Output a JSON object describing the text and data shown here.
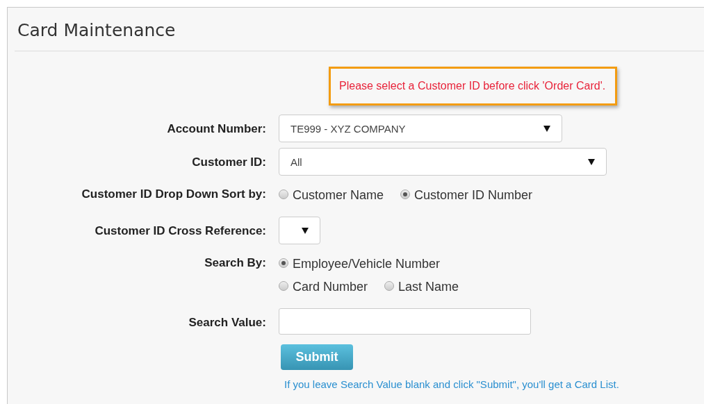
{
  "title": "Card Maintenance",
  "alert": "Please select a Customer ID before click 'Order Card'.",
  "fields": [
    {
      "kind": "select",
      "label": "Account Number:",
      "value": "TE999 - XYZ COMPANY"
    },
    {
      "kind": "select",
      "label": "Customer ID:",
      "value": "All"
    },
    {
      "kind": "radios",
      "label": "Customer ID Drop Down Sort by:",
      "lines": [
        [
          {
            "label": "Customer Name",
            "selected": false
          },
          {
            "label": "Customer ID Number",
            "selected": true
          }
        ]
      ]
    },
    {
      "kind": "select",
      "label": "Customer ID Cross Reference:"
    },
    {
      "kind": "radios",
      "label": "Search By:",
      "lines": [
        [
          {
            "label": "Employee/Vehicle Number",
            "selected": true
          }
        ],
        [
          {
            "label": "Card Number",
            "selected": false
          },
          {
            "label": "Last Name",
            "selected": false
          }
        ]
      ]
    },
    {
      "kind": "input",
      "label": "Search Value:"
    }
  ],
  "submit": "Submit",
  "note": "If you leave Search Value blank and click \"Submit\", you'll get a Card List."
}
